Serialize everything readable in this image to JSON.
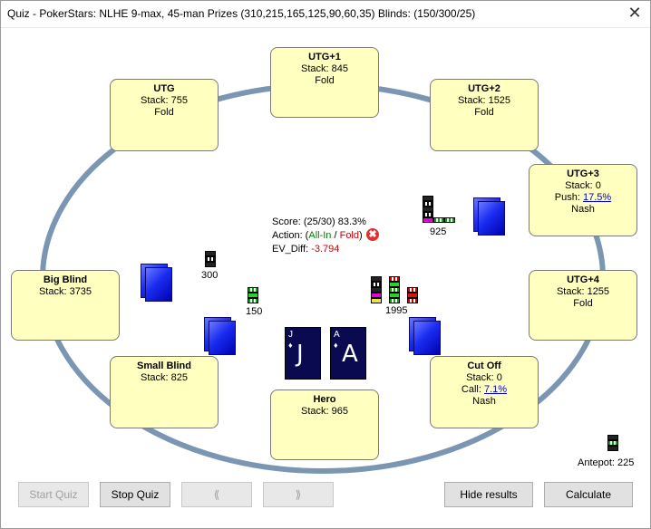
{
  "window": {
    "title": "Quiz - PokerStars: NLHE 9-max, 45-man Prizes (310,215,165,125,90,60,35) Blinds: (150/300/25)",
    "close_glyph": "✕"
  },
  "colors": {
    "seat_bg": "#ffffc0",
    "felt_ring": "#7b96b2",
    "card_back": "#1a2cf0",
    "link": "#0000cc"
  },
  "seats": {
    "utg1": {
      "name": "UTG+1",
      "stack": "Stack: 845",
      "action": "Fold"
    },
    "utg": {
      "name": "UTG",
      "stack": "Stack: 755",
      "action": "Fold"
    },
    "utg2": {
      "name": "UTG+2",
      "stack": "Stack: 1525",
      "action": "Fold"
    },
    "utg3": {
      "name": "UTG+3",
      "stack": "Stack: 0",
      "push_label": "Push:",
      "push_pct": "17.5%",
      "action": "Nash"
    },
    "utg4": {
      "name": "UTG+4",
      "stack": "Stack: 1255",
      "action": "Fold"
    },
    "bigblind": {
      "name": "Big Blind",
      "stack": "Stack: 3735"
    },
    "smallblind": {
      "name": "Small Blind",
      "stack": "Stack: 825"
    },
    "hero": {
      "name": "Hero",
      "stack": "Stack: 965"
    },
    "cutoff": {
      "name": "Cut Off",
      "stack": "Stack: 0",
      "call_label": "Call:",
      "call_pct": "7.1%",
      "action": "Nash"
    }
  },
  "bets": {
    "utg3": "925",
    "bigblind": "300",
    "smallblind": "150",
    "cutoff": "1995",
    "antepot": "Antepot: 225"
  },
  "result": {
    "score_label": "Score: (25/30) 83.3%",
    "action_prefix": "Action: (",
    "action_allin": "All-In",
    "action_sep": " / ",
    "action_fold": "Fold",
    "action_suffix": ")",
    "ev_label": "EV_Diff: ",
    "ev_value": "-3.794",
    "wrong_icon": "✖"
  },
  "hero_cards": [
    {
      "rank": "J",
      "suit": "♦",
      "face": "J"
    },
    {
      "rank": "A",
      "suit": "♦",
      "face": "A"
    }
  ],
  "buttons": {
    "start": "Start Quiz",
    "stop": "Stop Quiz",
    "prev": "⟪",
    "next": "⟫",
    "hide": "Hide results",
    "calculate": "Calculate"
  }
}
